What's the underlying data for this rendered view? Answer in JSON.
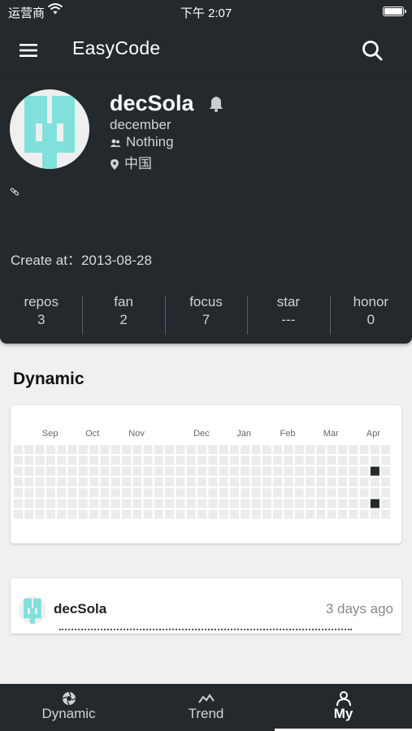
{
  "status": {
    "carrier": "运营商",
    "time": "下午 2:07"
  },
  "appbar": {
    "title": "EasyCode",
    "menu_icon": "menu-icon",
    "search_icon": "search-icon"
  },
  "profile": {
    "username": "decSola",
    "nickname": "december",
    "company": "Nothing",
    "location": "中国",
    "created_label": "Create at：",
    "created_date": "2013-08-28",
    "stats": [
      {
        "label": "repos",
        "value": "3"
      },
      {
        "label": "fan",
        "value": "2"
      },
      {
        "label": "focus",
        "value": "7"
      },
      {
        "label": "star",
        "value": "---"
      },
      {
        "label": "honor",
        "value": "0"
      }
    ]
  },
  "dynamic": {
    "title": "Dynamic",
    "months": [
      "Sep",
      "Oct",
      "Nov",
      "Dec",
      "Jan",
      "Feb",
      "Mar",
      "Apr"
    ],
    "active_cells": [
      {
        "week": 33,
        "day": 2
      },
      {
        "week": 33,
        "day": 5
      }
    ]
  },
  "event": {
    "user": "decSola",
    "time": "3 days ago"
  },
  "tabs": [
    {
      "label": "Dynamic",
      "icon": "aperture-icon",
      "active": false
    },
    {
      "label": "Trend",
      "icon": "trend-icon",
      "active": false
    },
    {
      "label": "My",
      "icon": "person-icon",
      "active": true
    }
  ],
  "colors": {
    "dark": "#24292e",
    "avatar_accent": "#7fe0dc",
    "heat_empty": "#ebebeb",
    "heat_active": "#24292e"
  }
}
